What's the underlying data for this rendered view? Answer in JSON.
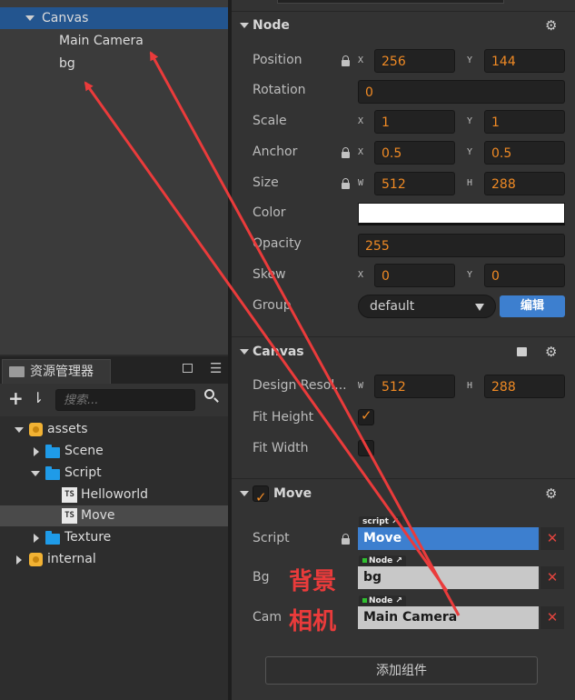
{
  "hierarchy": {
    "items": [
      {
        "label": "Canvas"
      },
      {
        "label": "Main Camera"
      },
      {
        "label": "bg"
      }
    ]
  },
  "assets": {
    "tab_label": "资源管理器",
    "search_placeholder": "搜索...",
    "tree": [
      {
        "label": "assets"
      },
      {
        "label": "Scene"
      },
      {
        "label": "Script"
      },
      {
        "label": "Helloworld",
        "badge": "TS"
      },
      {
        "label": "Move",
        "badge": "TS"
      },
      {
        "label": "Texture"
      },
      {
        "label": "internal"
      }
    ]
  },
  "inspector": {
    "node": {
      "title": "Node",
      "position": {
        "label": "Position",
        "x_axis": "X",
        "x": "256",
        "y_axis": "Y",
        "y": "144"
      },
      "rotation": {
        "label": "Rotation",
        "value": "0"
      },
      "scale": {
        "label": "Scale",
        "x_axis": "X",
        "x": "1",
        "y_axis": "Y",
        "y": "1"
      },
      "anchor": {
        "label": "Anchor",
        "x_axis": "X",
        "x": "0.5",
        "y_axis": "Y",
        "y": "0.5"
      },
      "size": {
        "label": "Size",
        "w_axis": "W",
        "w": "512",
        "h_axis": "H",
        "h": "288"
      },
      "color": {
        "label": "Color",
        "value": "#ffffff"
      },
      "opacity": {
        "label": "Opacity",
        "value": "255"
      },
      "skew": {
        "label": "Skew",
        "x_axis": "X",
        "x": "0",
        "y_axis": "Y",
        "y": "0"
      },
      "group": {
        "label": "Group",
        "value": "default",
        "edit_button": "编辑"
      }
    },
    "canvas": {
      "title": "Canvas",
      "design_resolution": {
        "label": "Design Resol...",
        "w_axis": "W",
        "w": "512",
        "h_axis": "H",
        "h": "288"
      },
      "fit_height": {
        "label": "Fit Height",
        "checked": true
      },
      "fit_width": {
        "label": "Fit Width",
        "checked": false
      }
    },
    "move": {
      "title": "Move",
      "enabled": true,
      "script": {
        "label": "Script",
        "tag": "script",
        "value": "Move"
      },
      "bg": {
        "label": "Bg",
        "tag": "Node",
        "value": "bg"
      },
      "cam": {
        "label": "Cam",
        "tag": "Node",
        "value": "Main Camera"
      }
    },
    "add_component_label": "添加组件"
  },
  "annotations": {
    "bg_note": "背景",
    "cam_note": "相机",
    "color": "#ea3b3b"
  }
}
